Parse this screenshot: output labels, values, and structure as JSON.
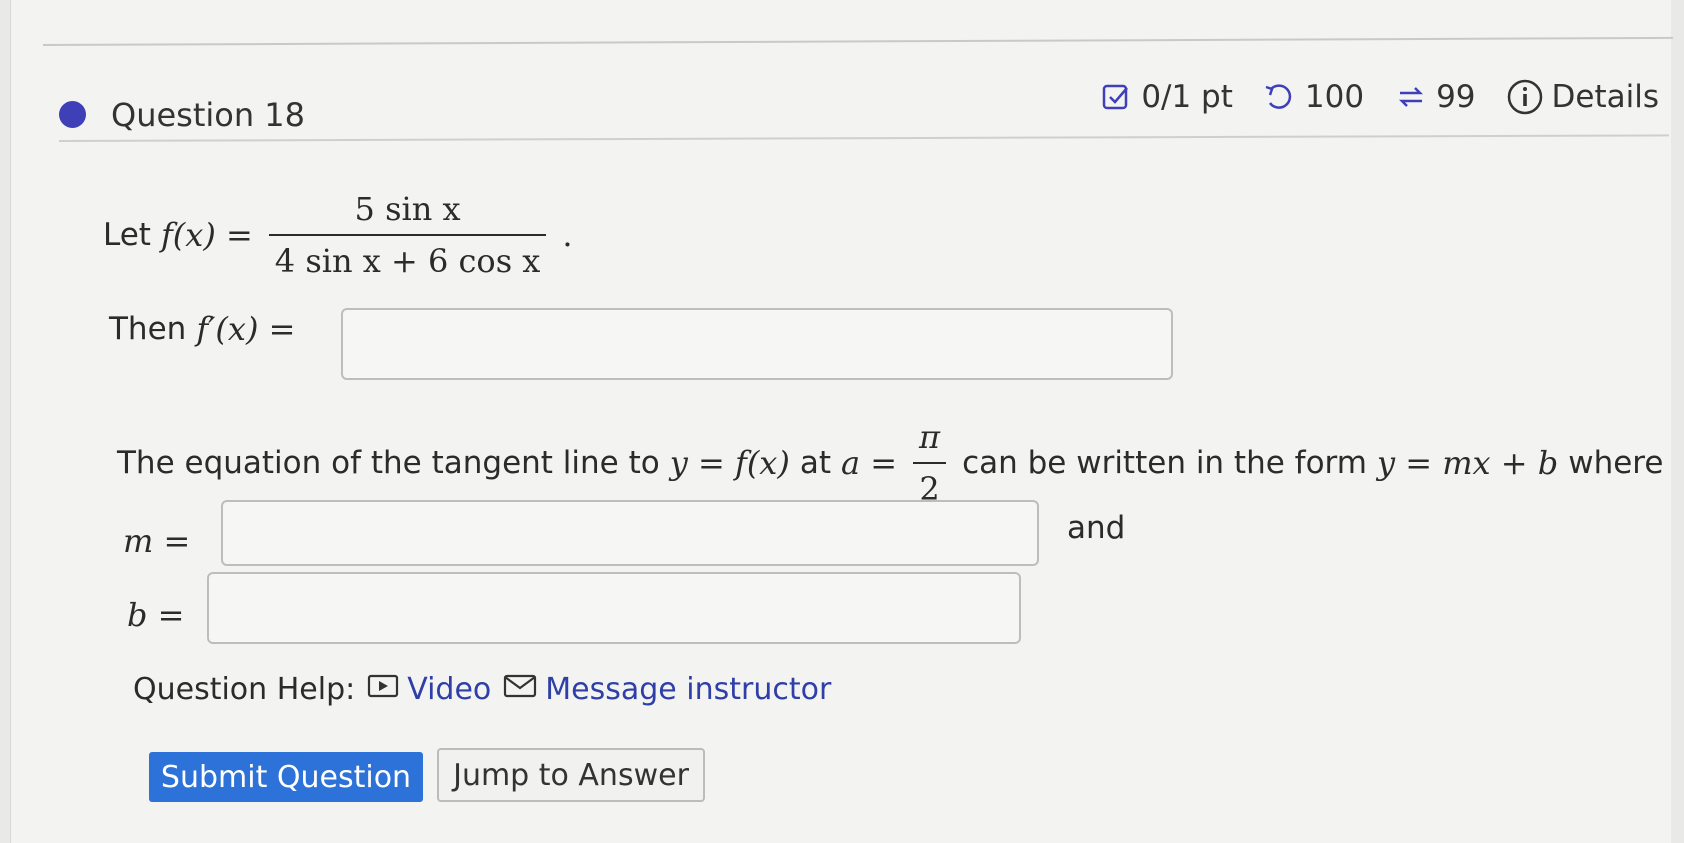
{
  "question": {
    "title": "Question 18",
    "points": "0/1 pt",
    "attempts_remaining": "100",
    "retries": "99",
    "details_label": "Details"
  },
  "problem": {
    "let_label": "Let",
    "f_lhs": "f(x) =",
    "numerator": "5 sin x",
    "denominator": "4 sin x + 6 cos x",
    "period": ".",
    "then_label": "Then",
    "fprime_lhs": "f′(x) =",
    "tangent_text_1": "The equation of the tangent line to",
    "tangent_expr_1": "y = f(x)",
    "tangent_text_2": "at",
    "tangent_expr_2": "a =",
    "pi_num": "π",
    "pi_den": "2",
    "tangent_text_3": "can be written in the form",
    "tangent_expr_3": "y = mx + b",
    "tangent_text_4": "where",
    "m_lhs": "m =",
    "and_label": "and",
    "b_lhs": "b ="
  },
  "inputs": {
    "fprime_value": "",
    "m_value": "",
    "b_value": ""
  },
  "help": {
    "label": "Question Help:",
    "video": "Video",
    "message": "Message instructor"
  },
  "buttons": {
    "submit": "Submit Question",
    "jump": "Jump to Answer"
  },
  "colors": {
    "accent": "#3f3fb8",
    "submit_bg": "#2d72d9",
    "link": "#2f3fa8"
  }
}
